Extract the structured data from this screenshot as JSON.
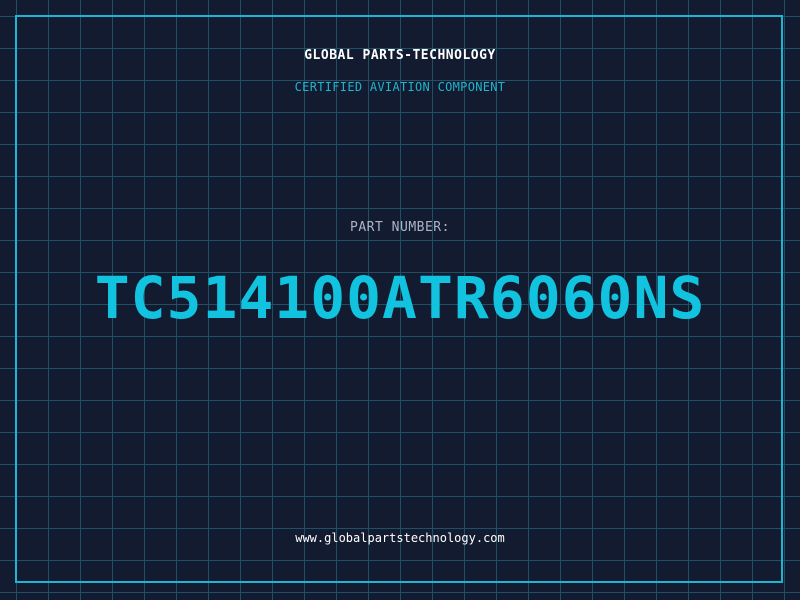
{
  "header": {
    "company": "GLOBAL PARTS-TECHNOLOGY",
    "tagline": "CERTIFIED AVIATION COMPONENT"
  },
  "part": {
    "label": "PART NUMBER:",
    "number": "TC514100ATR6060NS"
  },
  "footer": {
    "website": "www.globalpartstechnology.com"
  },
  "colors": {
    "background": "#121b2f",
    "grid": "#1f5066",
    "accent": "#1fb4cf",
    "part_number": "#12c3e0",
    "text_primary": "#ffffff",
    "text_muted": "#aab6c8"
  }
}
